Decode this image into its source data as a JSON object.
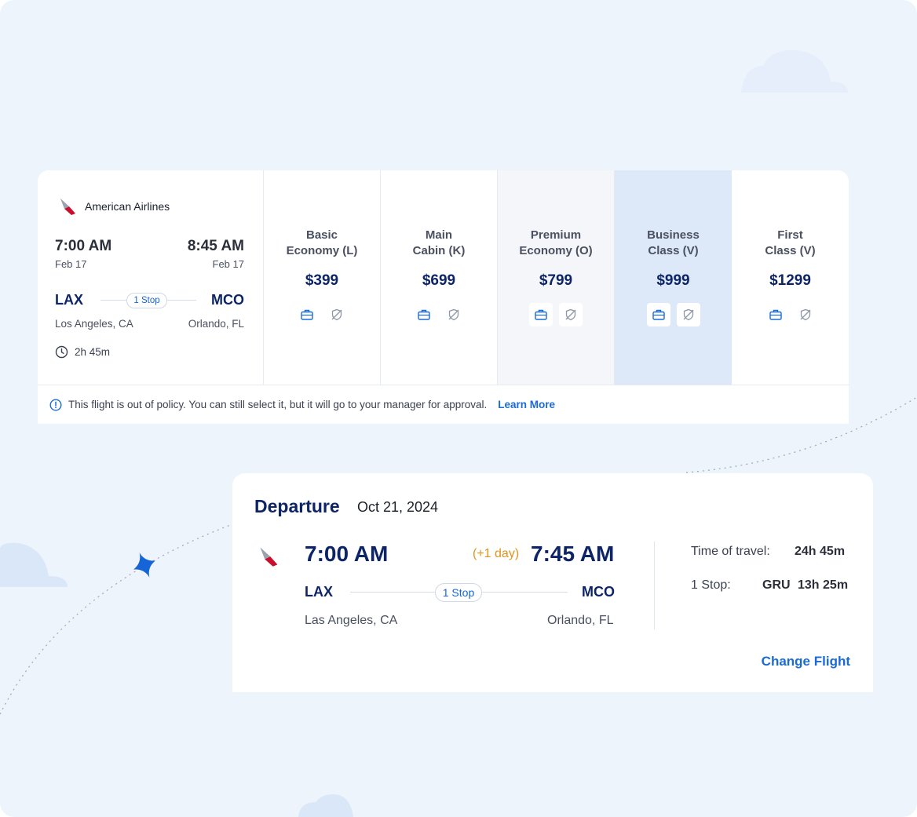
{
  "colors": {
    "background": "#eef4fc",
    "navy": "#0d2566",
    "link": "#1a6ad8",
    "highlight": "#dde9f8",
    "late": "#e0941a",
    "star": "#1565d8"
  },
  "flight_card": {
    "airline": "American Airlines",
    "airline_logo": "american-airlines-logo",
    "depart_time": "7:00 AM",
    "depart_date": "Feb 17",
    "arrive_time": "8:45 AM",
    "arrive_date": "Feb 17",
    "origin_code": "LAX",
    "destination_code": "MCO",
    "stops_label": "1 Stop",
    "origin_city": "Los Angeles, CA",
    "destination_city": "Orlando, FL",
    "duration": "2h 45m",
    "fares": [
      {
        "name": "Basic\nEconomy (L)",
        "price": "$399",
        "icons": [
          "briefcase-icon",
          "no-refund-icon"
        ],
        "style": "default"
      },
      {
        "name": "Main\nCabin (K)",
        "price": "$699",
        "icons": [
          "briefcase-icon",
          "no-refund-icon"
        ],
        "style": "default"
      },
      {
        "name": "Premium\nEconomy (O)",
        "price": "$799",
        "icons": [
          "briefcase-icon",
          "no-refund-icon"
        ],
        "style": "muted"
      },
      {
        "name": "Business\nClass (V)",
        "price": "$999",
        "icons": [
          "briefcase-icon",
          "no-refund-icon"
        ],
        "style": "selected"
      },
      {
        "name": "First\nClass (V)",
        "price": "$1299",
        "icons": [
          "briefcase-icon",
          "no-refund-icon"
        ],
        "style": "default"
      }
    ],
    "policy_message": "This flight is out of policy. You can still select it, but it will go to your manager for approval.",
    "learn_more": "Learn More"
  },
  "departure": {
    "title": "Departure",
    "date": "Oct 21, 2024",
    "depart_time": "7:00 AM",
    "day_offset": "(+1 day)",
    "arrive_time": "7:45 AM",
    "origin_code": "LAX",
    "destination_code": "MCO",
    "stops_label": "1 Stop",
    "origin_city": "Las Angeles, CA",
    "destination_city": "Orlando, FL",
    "time_of_travel_label": "Time of travel:",
    "time_of_travel": "24h 45m",
    "stop_label": "1 Stop:",
    "stop_airport": "GRU",
    "stop_duration": "13h 25m",
    "change_flight": "Change Flight"
  }
}
